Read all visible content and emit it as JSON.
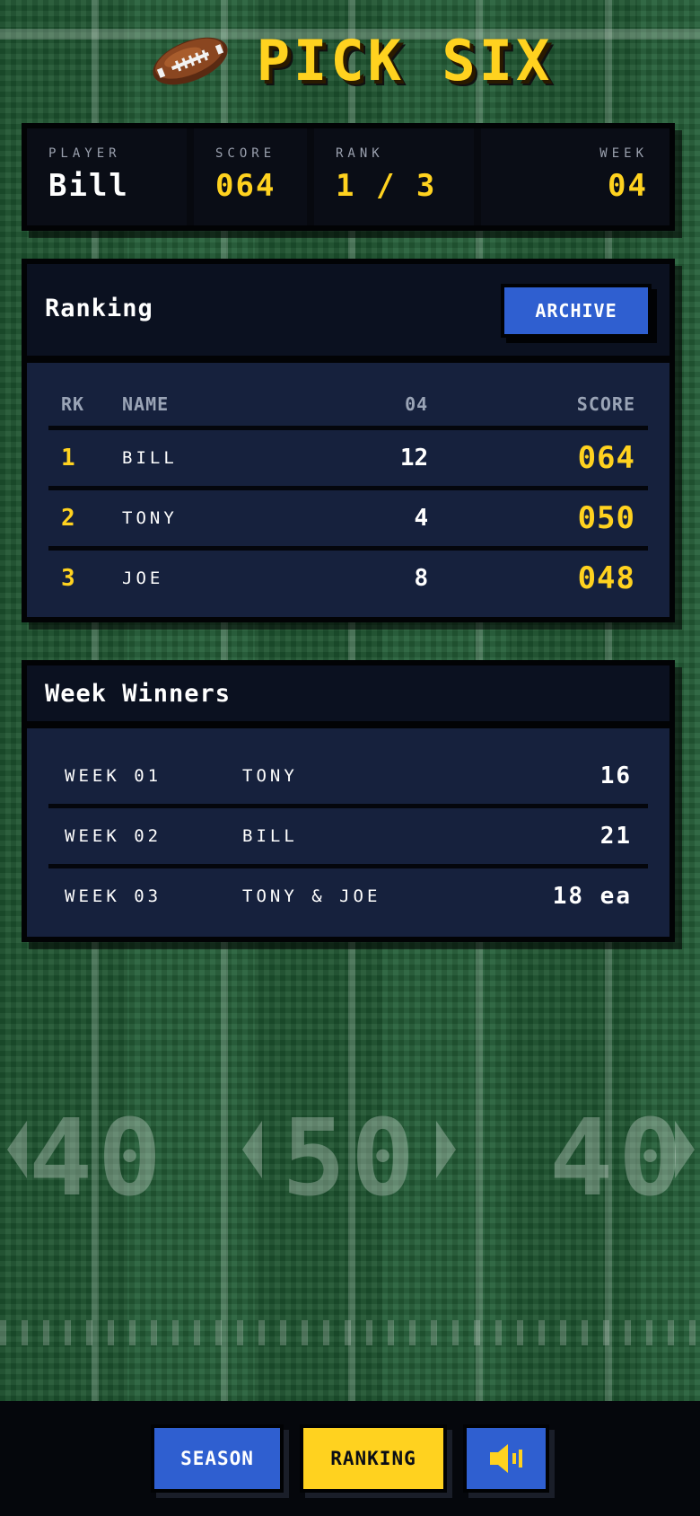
{
  "app": {
    "title": "PICK SIX"
  },
  "stats": {
    "player": {
      "label": "PLAYER",
      "value": "Bill"
    },
    "score": {
      "label": "SCORE",
      "value": "064"
    },
    "rank": {
      "label": "RANK",
      "value": "1 / 3"
    },
    "week": {
      "label": "WEEK",
      "value": "04"
    }
  },
  "ranking": {
    "title": "Ranking",
    "archive_label": "ARCHIVE",
    "headers": {
      "rk": "RK",
      "name": "NAME",
      "week": "04",
      "score": "SCORE"
    },
    "rows": [
      {
        "rk": "1",
        "name": "BILL",
        "week": "12",
        "score": "064"
      },
      {
        "rk": "2",
        "name": "TONY",
        "week": "4",
        "score": "050"
      },
      {
        "rk": "3",
        "name": "JOE",
        "week": "8",
        "score": "048"
      }
    ]
  },
  "winners": {
    "title": "Week Winners",
    "rows": [
      {
        "week": "WEEK 01",
        "name": "TONY",
        "points": "16"
      },
      {
        "week": "WEEK 02",
        "name": "BILL",
        "points": "21"
      },
      {
        "week": "WEEK 03",
        "name": "TONY & JOE",
        "points": "18 ea"
      }
    ]
  },
  "field": {
    "numbers": [
      "40",
      "50",
      "40"
    ]
  },
  "nav": {
    "season_label": "SEASON",
    "ranking_label": "RANKING",
    "sound_icon": "speaker-icon"
  },
  "colors": {
    "accent_yellow": "#ffd21f",
    "button_blue": "#2f5fd0",
    "panel_navy": "#16213d",
    "field_green": "#1f5a33"
  }
}
